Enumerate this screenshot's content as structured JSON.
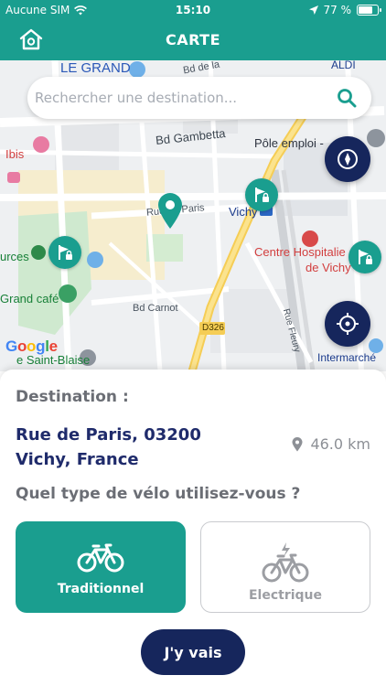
{
  "status_bar": {
    "carrier": "Aucune SIM",
    "time": "15:10",
    "battery": "77 %",
    "battery_level": 0.77
  },
  "header": {
    "title": "CARTE"
  },
  "search": {
    "placeholder": "Rechercher une destination..."
  },
  "map": {
    "labels": {
      "le_grand": "LE GRAND",
      "bd_de_la": "Bd de la",
      "aldi": "ALDI",
      "bd_gambetta": "Bd Gambetta",
      "pole_emploi": "Pôle emploi -",
      "ibis": "Ibis",
      "rue_paris": "Rue de Paris",
      "vichy": "Vichy",
      "centre_hosp_1": "Centre Hospitalie",
      "centre_hosp_2": "de Vichy",
      "sources": "urces",
      "grand_cafe": "Grand café",
      "bd_carnot": "Bd Carnot",
      "d326": "D326",
      "saint_blaise": "e Saint-Blaise",
      "intermarche": "Intermarché",
      "rue_fleury": "Rue Fleury",
      "google": "Google"
    }
  },
  "destination": {
    "label": "Destination :",
    "address": "Rue de Paris, 03200 Vichy, France",
    "distance": "46.0 km"
  },
  "bike_type": {
    "question": "Quel type de vélo utilisez-vous ?",
    "options": [
      {
        "label": "Traditionnel",
        "selected": true
      },
      {
        "label": "Electrique",
        "selected": false
      }
    ]
  },
  "go_button": "J'y vais",
  "colors": {
    "teal": "#1a9e8f",
    "navy": "#16265c",
    "text_dark": "#1f2b6b",
    "text_grey": "#6b6e75"
  }
}
